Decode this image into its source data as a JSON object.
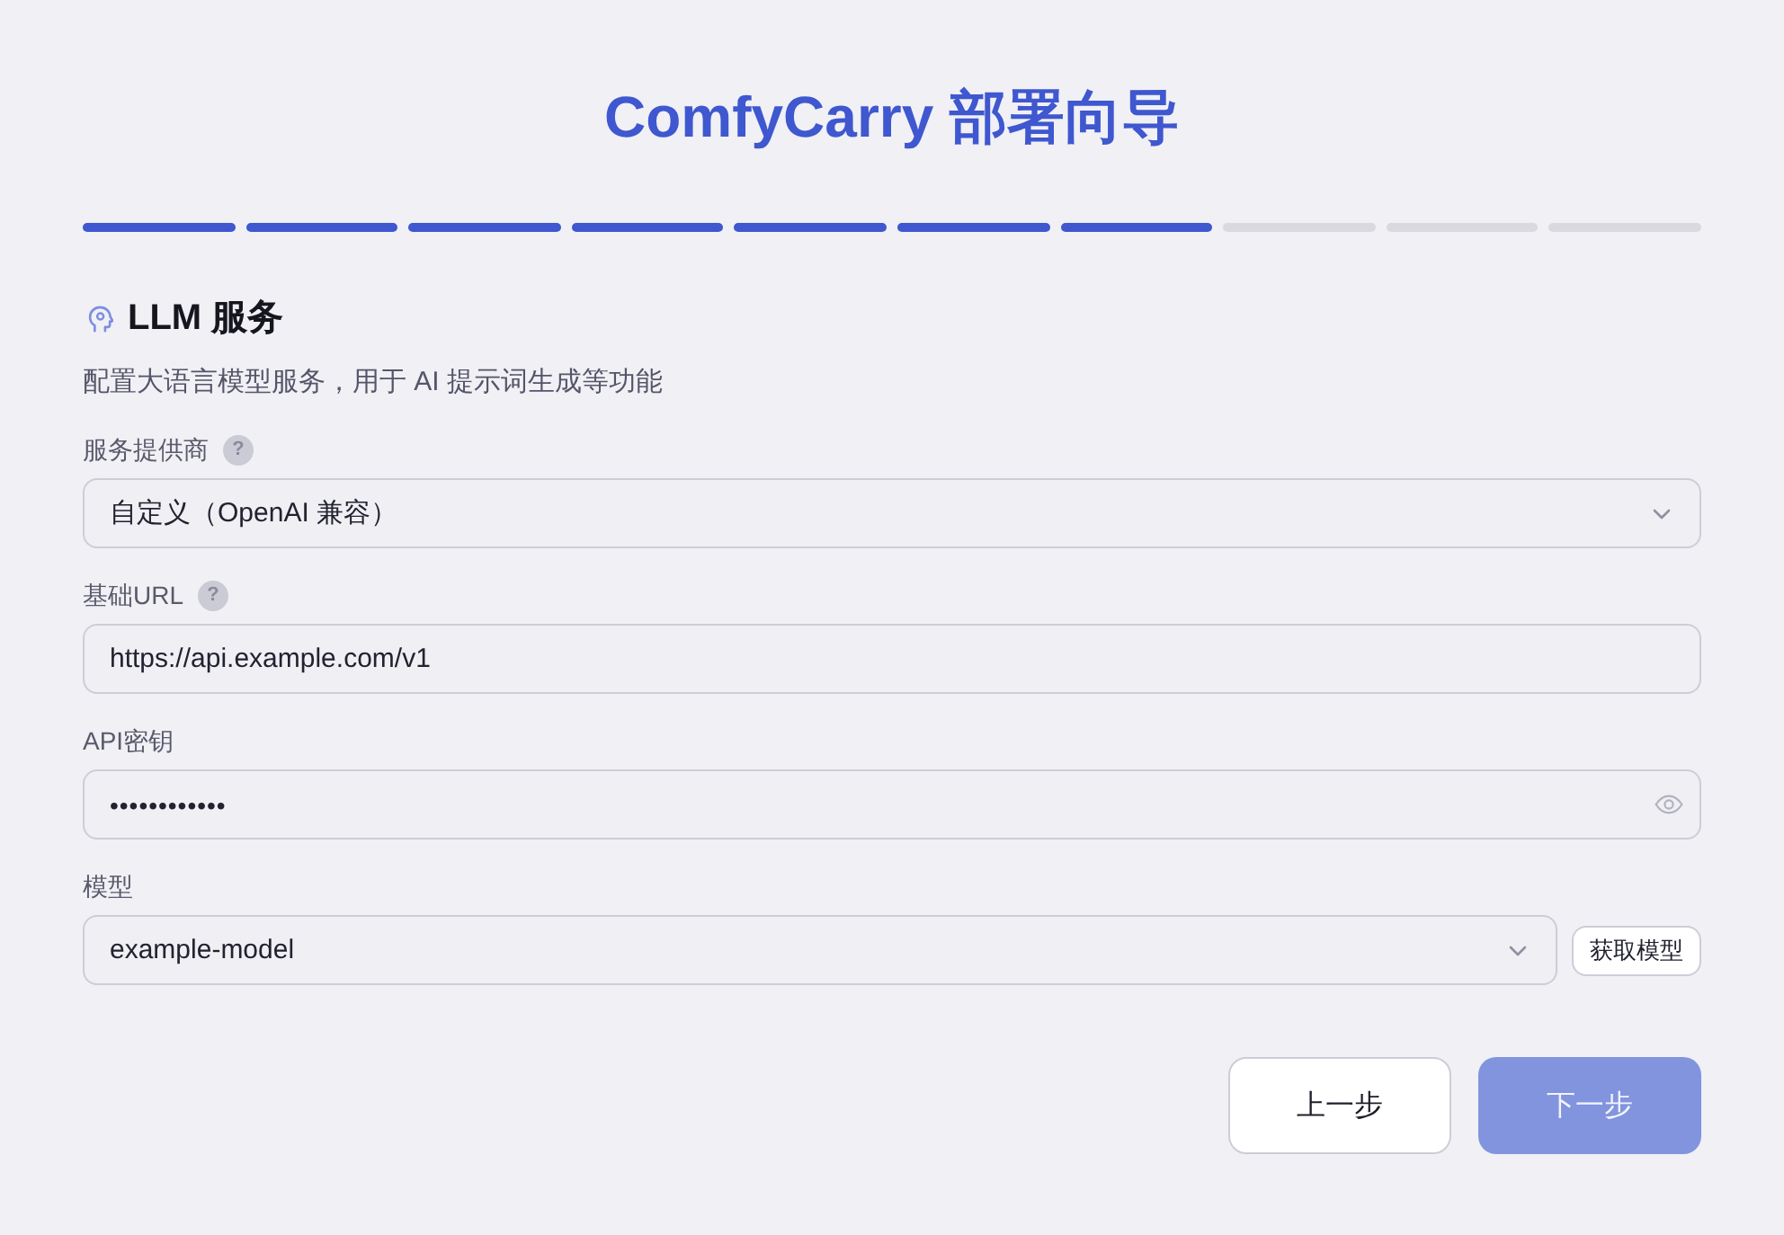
{
  "title": "ComfyCarry 部署向导",
  "progress": {
    "steps": [
      {
        "completed": true
      },
      {
        "completed": true
      },
      {
        "completed": true
      },
      {
        "completed": true
      },
      {
        "completed": true
      },
      {
        "completed": true
      },
      {
        "completed": true
      },
      {
        "completed": false
      },
      {
        "completed": false
      },
      {
        "completed": false
      }
    ]
  },
  "section": {
    "title": "LLM 服务",
    "description": "配置大语言模型服务，用于 AI 提示词生成等功能"
  },
  "fields": [
    {
      "kind": "select",
      "label": "服务提供商",
      "help": "?",
      "value": "自定义（OpenAI 兼容）"
    },
    {
      "kind": "text",
      "label": "基础URL",
      "help": "?",
      "value": "https://api.example.com/v1"
    },
    {
      "kind": "password",
      "label": "API密钥",
      "value": "••••••••••••"
    },
    {
      "kind": "select",
      "label": "模型",
      "value": "example-model",
      "action": "获取模型"
    }
  ],
  "buttons": [
    {
      "label": "上一步",
      "kind": "secondary",
      "disabled": false
    },
    {
      "label": "下一步",
      "kind": "primary",
      "disabled": true
    }
  ]
}
